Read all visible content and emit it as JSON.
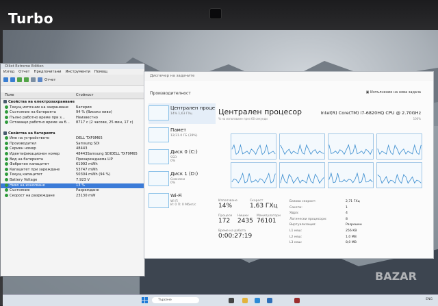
{
  "overlay": {
    "watermark": "Turbo",
    "bazar": "BAZAR"
  },
  "aida": {
    "title": "Оlliot Extreme Edition",
    "menu": [
      "Изгед",
      "Отчет",
      "Предпочитани",
      "Инструменти",
      "Помощ"
    ],
    "toolbar_report": "Отчет",
    "col_field": "Поле",
    "col_value": "Стойност",
    "rows": [
      {
        "f": "Свойства на електрозахранването",
        "v": "",
        "sec": true
      },
      {
        "f": "Текущ източник на захранване",
        "v": "Батерия"
      },
      {
        "f": "Състояние на батерията",
        "v": "94 % (Високо ниво)"
      },
      {
        "f": "Пълно работно време при з...",
        "v": "Неизвестно"
      },
      {
        "f": "Оставащо работно време на б...",
        "v": "8717 с (2 часове, 25 мин, 17 с)"
      },
      {
        "f": "",
        "v": ""
      },
      {
        "f": "Свойства на батерията",
        "v": "",
        "sec": true
      },
      {
        "f": "Име на устройството",
        "v": "DELL TXF9M65"
      },
      {
        "f": "Производител",
        "v": "Samsung SDI"
      },
      {
        "f": "Сериен номер",
        "v": "48443"
      },
      {
        "f": "Идентификационен номер",
        "v": "48443Samsung SDIDELL TXF9M65"
      },
      {
        "f": "Вид на батерията",
        "v": "Презареждаема LIP"
      },
      {
        "f": "Фабричен капацитет",
        "v": "61992 mWh"
      },
      {
        "f": "Капацитет при зареждане",
        "v": "53747 mWh"
      },
      {
        "f": "Текущ капацитет",
        "v": "50304 mWh  (94 %)"
      },
      {
        "f": "Battery Voltage",
        "v": "7.923 V"
      },
      {
        "f": "Ниво на износване",
        "v": "13 %",
        "sel": true
      },
      {
        "f": "Състояние",
        "v": "Разреждане"
      },
      {
        "f": "Скорост на разреждане",
        "v": "23130 mW"
      }
    ]
  },
  "tm": {
    "title": "Диспечер на задачите",
    "header": "Производителност",
    "header_right": "Изпълнение на нова задача",
    "sidebar": [
      {
        "name": "Централен проце",
        "sub": "14% 1,63 ГХц",
        "active": true
      },
      {
        "name": "Памет",
        "sub": "12/31.0 ГБ (39%)"
      },
      {
        "name": "Диск 0 (C:)",
        "sub": "SSD\n0%"
      },
      {
        "name": "Диск 1 (D:)",
        "sub": "Сменяем\n0%"
      },
      {
        "name": "Wi-Fi",
        "sub": "Wi-Fi\nИ: 0 П: 0 Мбит/с"
      }
    ],
    "cpu_title": "Централен процесор",
    "cpu_model": "Intel(R) Core(TM) i7-6820HQ CPU @ 2.70GHz",
    "caption": "% на използване през 60 секунди",
    "pct": "100%",
    "stats": [
      {
        "lab": "Използване",
        "val": "14%"
      },
      {
        "lab": "Скорост",
        "val": "1,63 ГХц"
      },
      {
        "lab": "Процеси",
        "val": "172"
      },
      {
        "lab": "Нишки",
        "val": "2435"
      },
      {
        "lab": "Манипулатори",
        "val": "76101"
      },
      {
        "lab": "Време на работа",
        "val": "0:00:27:19"
      }
    ],
    "specs": [
      {
        "k": "Базова скорост:",
        "v": "2,71 ГХц"
      },
      {
        "k": "Сокети:",
        "v": "1"
      },
      {
        "k": "Ядра:",
        "v": "4"
      },
      {
        "k": "Логически процесори:",
        "v": "8"
      },
      {
        "k": "Виртуализация:",
        "v": "Разрешен"
      },
      {
        "k": "L1 кеш:",
        "v": "256 KB"
      },
      {
        "k": "L2 кеш:",
        "v": "1,0 MB"
      },
      {
        "k": "L3 кеш:",
        "v": "8,0 MB"
      }
    ]
  },
  "taskbar": {
    "search": "Търсене",
    "tray": "ENG"
  }
}
